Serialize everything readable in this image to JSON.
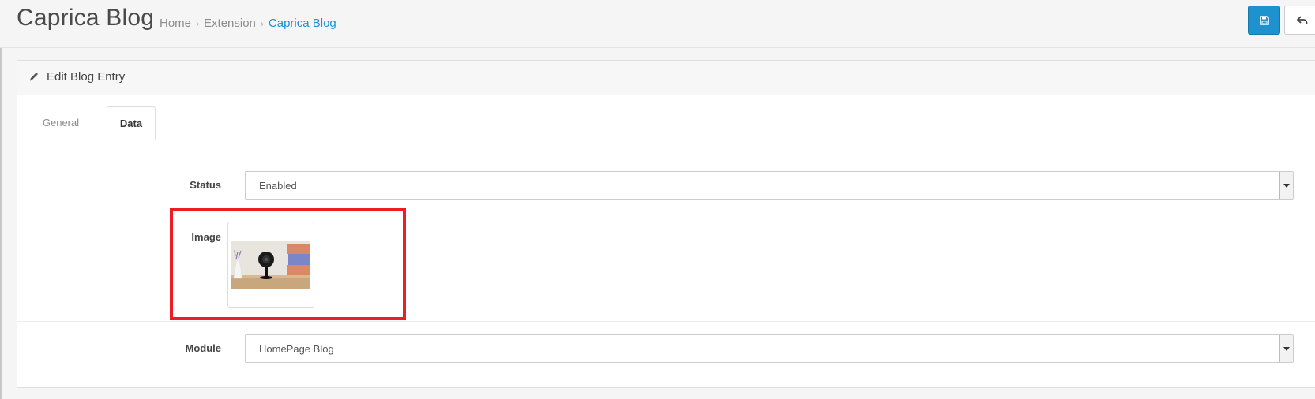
{
  "header": {
    "title": "Caprica Blog",
    "breadcrumb": [
      "Home",
      "Extension",
      "Caprica Blog"
    ],
    "save_icon": "save-icon",
    "back_icon": "reply-icon"
  },
  "panel": {
    "title": "Edit Blog Entry",
    "title_icon": "pencil-icon"
  },
  "tabs": [
    {
      "label": "General",
      "active": false
    },
    {
      "label": "Data",
      "active": true
    }
  ],
  "form": {
    "status": {
      "label": "Status",
      "value": "Enabled"
    },
    "image": {
      "label": "Image",
      "thumbnail": "security-camera-image"
    },
    "module": {
      "label": "Module",
      "value": "HomePage Blog"
    }
  },
  "colors": {
    "accent": "#1e91cf",
    "highlight": "#ee1c23"
  }
}
